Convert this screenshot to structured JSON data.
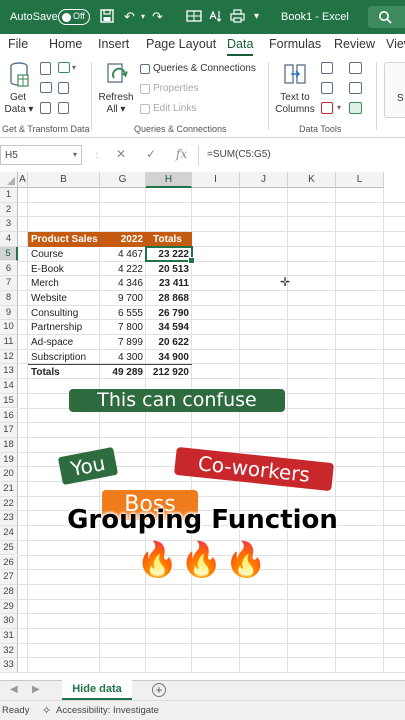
{
  "titlebar": {
    "autosave_label": "AutoSave",
    "autosave_state": "Off",
    "document_title": "Book1 - Excel",
    "accent_color": "#217346"
  },
  "menu_tabs": [
    "File",
    "Home",
    "Insert",
    "Page Layout",
    "Data",
    "Formulas",
    "Review",
    "View"
  ],
  "active_tab": "Data",
  "ribbon": {
    "get_data": {
      "line1": "Get",
      "line2": "Data ▾"
    },
    "refresh_all": {
      "line1": "Refresh",
      "line2": "All ▾"
    },
    "queries_connections": "Queries & Connections",
    "properties": "Properties",
    "edit_links": "Edit Links",
    "text_to_columns": {
      "line1": "Text to",
      "line2": "Columns"
    },
    "groups": {
      "get_transform": "Get & Transform Data",
      "queries": "Queries & Connections",
      "data_tools": "Data Tools"
    }
  },
  "formula_bar": {
    "name_box": "H5",
    "cancel_symbol": "✕",
    "enter_symbol": "✓",
    "fx_symbol": "fx",
    "formula": "=SUM(C5:G5)"
  },
  "grid": {
    "columns": [
      "A",
      "B",
      "G",
      "H",
      "I",
      "J",
      "K",
      "L"
    ],
    "selected_column": "H",
    "rows": [
      "1",
      "2",
      "3",
      "4",
      "5",
      "6",
      "7",
      "8",
      "9",
      "10",
      "11",
      "12",
      "13",
      "14",
      "15",
      "16",
      "17",
      "18",
      "19",
      "20",
      "21",
      "22",
      "23",
      "24",
      "25",
      "26",
      "27",
      "28",
      "29",
      "30",
      "31",
      "32",
      "33"
    ],
    "selected_row": "5"
  },
  "table": {
    "header": {
      "label": "Product Sales",
      "year": "2022",
      "totals": "Totals",
      "color": "#c55a11"
    },
    "rows": [
      {
        "label": "Course",
        "year": "4 467",
        "totals": "23 222"
      },
      {
        "label": "E-Book",
        "year": "4 222",
        "totals": "20 513"
      },
      {
        "label": "Merch",
        "year": "4 346",
        "totals": "23 411"
      },
      {
        "label": "Website",
        "year": "9 700",
        "totals": "28 868"
      },
      {
        "label": "Consulting",
        "year": "6 555",
        "totals": "26 790"
      },
      {
        "label": "Partnership",
        "year": "7 800",
        "totals": "34 594"
      },
      {
        "label": "Ad-space",
        "year": "7 899",
        "totals": "20 622"
      },
      {
        "label": "Subscription",
        "year": "4 300",
        "totals": "34 900"
      }
    ],
    "total_row": {
      "label": "Totals",
      "year": "49 289",
      "totals": "212 920"
    }
  },
  "overlay": {
    "banner": {
      "text": "This can confuse",
      "color": "#2e6b3f"
    },
    "you": {
      "text": "You",
      "color": "#2e6b3f"
    },
    "coworkers": {
      "text": "Co-workers",
      "color": "#c8282c"
    },
    "boss": {
      "text": "Boss",
      "color": "#f07c1c"
    },
    "title": "Grouping Function",
    "flames": "🔥🔥🔥"
  },
  "sheets": {
    "active": "Hide data",
    "add_symbol": "+"
  },
  "status": {
    "ready": "Ready",
    "accessibility": "Accessibility: Investigate"
  }
}
